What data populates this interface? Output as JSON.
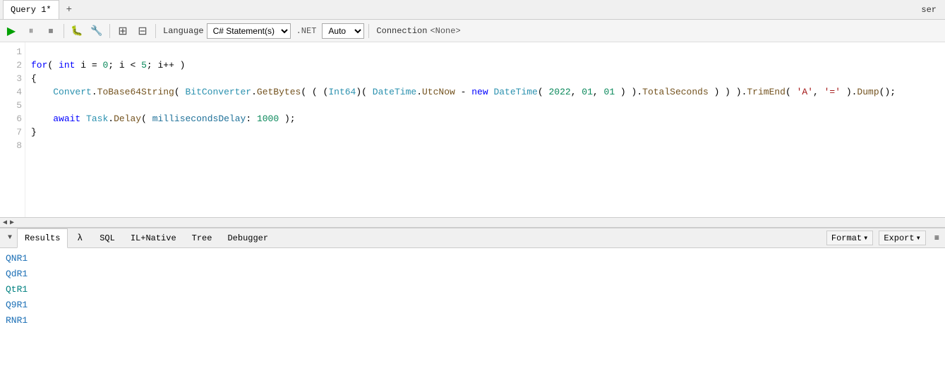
{
  "tabs": [
    {
      "label": "Query 1*",
      "active": true
    },
    {
      "label": "+",
      "isAdd": true
    }
  ],
  "tab_right_label": "ser",
  "toolbar": {
    "run_label": "▶",
    "pause_label": "⏸",
    "stop_label": "⏹",
    "bug_label": "🐛",
    "bug2_label": "🔧",
    "grid1_label": "▦",
    "grid2_label": "▦",
    "language_label": "Language",
    "language_value": "C# Statement(s)",
    "dotnet_label": ".NET",
    "auto_label": "Auto",
    "connection_label": "Connection",
    "connection_value": "<None>"
  },
  "code": {
    "lines": [
      {
        "num": 1,
        "content": "for_loop_line"
      },
      {
        "num": 2,
        "content": "open_brace"
      },
      {
        "num": 3,
        "content": "convert_line"
      },
      {
        "num": 4,
        "content": "empty"
      },
      {
        "num": 5,
        "content": "await_line"
      },
      {
        "num": 6,
        "content": "close_brace"
      },
      {
        "num": 7,
        "content": "empty"
      },
      {
        "num": 8,
        "content": "empty"
      }
    ]
  },
  "results_panel": {
    "tabs": [
      {
        "label": "Results",
        "active": true
      },
      {
        "label": "λ",
        "isLambda": true
      },
      {
        "label": "SQL"
      },
      {
        "label": "IL+Native"
      },
      {
        "label": "Tree"
      },
      {
        "label": "Debugger"
      }
    ],
    "format_label": "Format",
    "export_label": "Export",
    "results": [
      {
        "value": "QNR1",
        "color": "blue"
      },
      {
        "value": "QdR1",
        "color": "blue"
      },
      {
        "value": "QtR1",
        "color": "teal"
      },
      {
        "value": "Q9R1",
        "color": "blue"
      },
      {
        "value": "RNR1",
        "color": "blue"
      }
    ]
  }
}
